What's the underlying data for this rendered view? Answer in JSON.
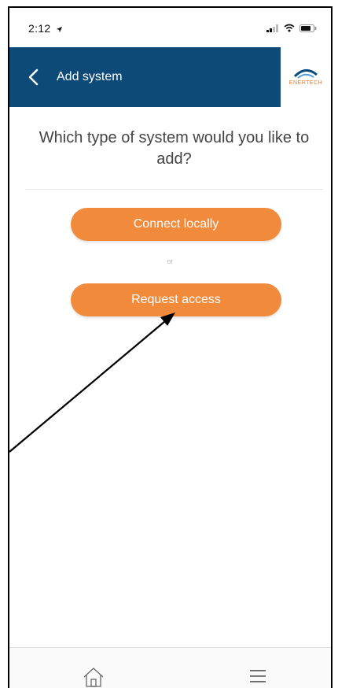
{
  "status_bar": {
    "time": "2:12",
    "icons": [
      "location-arrow-icon",
      "signal-icon",
      "wifi-icon",
      "battery-icon"
    ]
  },
  "header": {
    "title": "Add system",
    "back_icon": "chevron-left-icon",
    "logo_text": "ENERTECH",
    "background_color": "#0d4a78"
  },
  "main": {
    "question": "Which type of system would you like to add?",
    "connect_label": "Connect locally",
    "or_label": "or",
    "request_label": "Request access",
    "button_color": "#f28a3c"
  },
  "tab_bar": {
    "items": [
      "home-icon",
      "menu-icon"
    ]
  }
}
